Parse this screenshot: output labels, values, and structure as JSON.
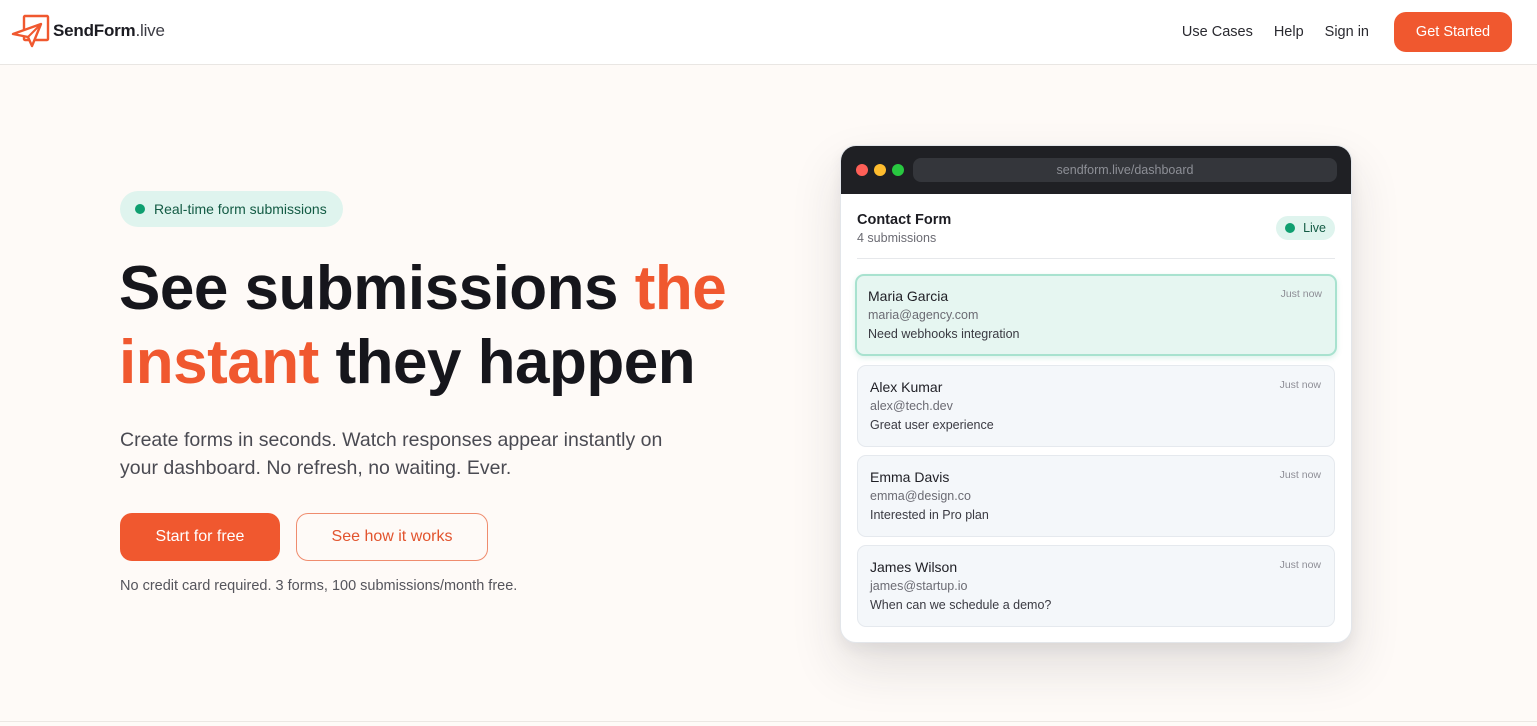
{
  "brand": {
    "name": "SendForm",
    "tld": ".live"
  },
  "nav": {
    "links": [
      "Use Cases",
      "Help",
      "Sign in"
    ],
    "cta": "Get Started"
  },
  "hero": {
    "badge": "Real-time form submissions",
    "headline": {
      "part1": "See submissions ",
      "accent1": "the",
      "accent2": "instant",
      "part2": " they happen"
    },
    "subtext": "Create forms in seconds. Watch responses appear instantly on your dashboard. No refresh, no waiting. Ever.",
    "primary_cta": "Start for free",
    "secondary_cta": "See how it works",
    "fineprint": "No credit card required. 3 forms, 100 submissions/month free."
  },
  "dashboard": {
    "url": "sendform.live/dashboard",
    "form_title": "Contact Form",
    "submission_count": "4 submissions",
    "status": "Live",
    "submissions": [
      {
        "name": "Maria Garcia",
        "email": "maria@agency.com",
        "message": "Need webhooks integration",
        "time": "Just now"
      },
      {
        "name": "Alex Kumar",
        "email": "alex@tech.dev",
        "message": "Great user experience",
        "time": "Just now"
      },
      {
        "name": "Emma Davis",
        "email": "emma@design.co",
        "message": "Interested in Pro plan",
        "time": "Just now"
      },
      {
        "name": "James Wilson",
        "email": "james@startup.io",
        "message": "When can we schedule a demo?",
        "time": "Just now"
      }
    ]
  },
  "colors": {
    "accent": "#f0582f",
    "live_green": "#0f9f70",
    "badge_bg": "#dff4ee",
    "page_bg": "#fefaf7"
  }
}
